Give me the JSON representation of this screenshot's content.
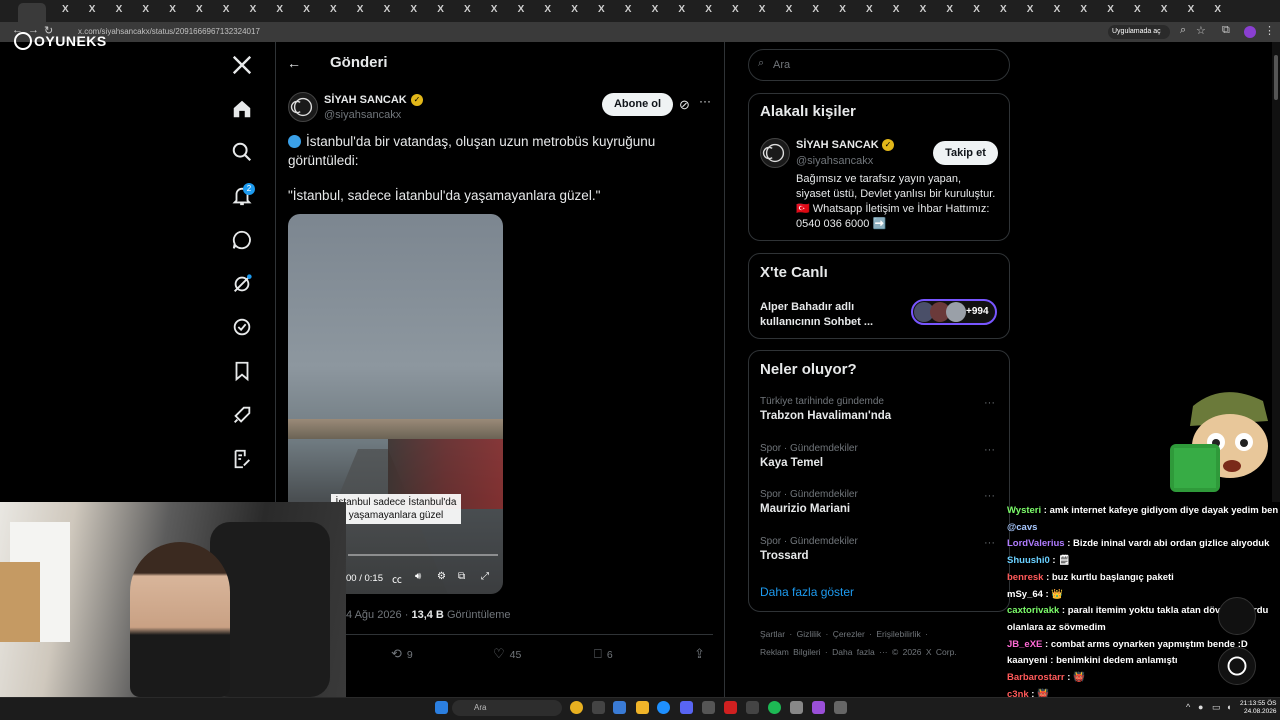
{
  "browser": {
    "url": "x.com/siyahsancakx/status/2091666967132324017",
    "app_chip": "Uygulamada aç"
  },
  "stream_overlay": {
    "logo_text": "OYUNEKS"
  },
  "nav": {
    "notification_count": "2",
    "icons": [
      "x-logo-icon",
      "home-icon",
      "search-icon",
      "bell-icon",
      "messages-icon",
      "grok-icon",
      "verified-org-icon",
      "bookmark-icon",
      "rocket-icon",
      "compose-list-icon"
    ]
  },
  "post": {
    "header_title": "Gönderi",
    "author_name": "SİYAH SANCAK",
    "author_handle": "@siyahsancakx",
    "subscribe_label": "Abone ol",
    "text_line1": "İstanbul'da bir vatandaş, oluşan uzun metrobüs kuyruğunu",
    "text_line2": "görüntüledi:",
    "text_line3": "\"İstanbul, sadece İatanbul'da yaşamayanlara güzel.\"",
    "video_caption": "İstanbul sadece İstanbul'da yaşamayanlara güzel",
    "video_time": "0:00 / 0:15",
    "video_time_visible": "00 / 0:15",
    "date": "4 Ağu 2026",
    "views": "13,4 B",
    "views_label": "Görüntüleme",
    "reposts": "9",
    "likes": "45",
    "bookmarks": "6"
  },
  "sidebar": {
    "search_placeholder": "Ara",
    "related": {
      "title": "Alakalı kişiler",
      "name": "SİYAH SANCAK",
      "handle": "@siyahsancakx",
      "follow_label": "Takip et",
      "bio": "Bağımsız ve tarafsız yayın yapan, siyaset üstü, Devlet yanlısı bir kuruluştur. 🇹🇷 Whatsapp İletişim ve İhbar Hattımız: 0540 036 6000 ➡️"
    },
    "live": {
      "title": "X'te Canlı",
      "text": "Alper Bahadır adlı kullanıcının Sohbet ...",
      "count": "+994"
    },
    "trends": {
      "title": "Neler oluyor?",
      "items": [
        {
          "meta": "Türkiye tarihinde gündemde",
          "name": "Trabzon Havalimanı'nda"
        },
        {
          "meta": "Spor · Gündemdekiler",
          "name": "Kaya Temel"
        },
        {
          "meta": "Spor · Gündemdekiler",
          "name": "Maurizio Mariani"
        },
        {
          "meta": "Spor · Gündemdekiler",
          "name": "Trossard"
        }
      ],
      "show_more": "Daha fazla göster"
    },
    "footer_line1": "Şartlar · Gizlilik · Çerezler · Erişilebilirlik ·",
    "footer_line2": "Reklam Bilgileri · Daha fazla ··· © 2026 X Corp."
  },
  "chat": [
    {
      "user": "Wysteri",
      "msg": " : amk internet kafeye gidiyom diye dayak yedim ben",
      "color": "#7cfc6a"
    },
    {
      "user": "@cavs",
      "msg": "",
      "color": "#a8c8ff"
    },
    {
      "user": "LordValerius",
      "msg": " : Bizde ininal vardı abi ordan gizlice alıyoduk",
      "color": "#b07cff"
    },
    {
      "user": "Shuushi0",
      "msg": " : 🗒",
      "color": "#6ad0ff"
    },
    {
      "user": "benresk",
      "msg": " : buz kurtlu başlangıç paketi",
      "color": "#ff5a5a"
    },
    {
      "user": "mSy_64",
      "msg": " : 👑",
      "color": "#ffffff"
    },
    {
      "user": "caxtorivakk",
      "msg": " : paralı itemim yoktu takla atan dövmeli kurdu",
      "color": "#7cfc6a"
    },
    {
      "user": "",
      "msg": "olanlara az sövmedim",
      "color": "#ffffff"
    },
    {
      "user": "JB_eXE",
      "msg": " : combat arms oynarken yapmıştım bende :D",
      "color": "#ff6ad5"
    },
    {
      "user": "kaanyeni",
      "msg": " : benimkini dedem anlamıştı",
      "color": "#ffffff"
    },
    {
      "user": "Barbarostarr",
      "msg": " : 👹",
      "color": "#ff5a5a"
    },
    {
      "user": "c3nk",
      "msg": " : 👹",
      "color": "#ff5a5a"
    }
  ],
  "taskbar": {
    "search_placeholder": "Ara",
    "time": "21:13:55 ÖS",
    "date": "24.08.2026"
  },
  "colors": {
    "accent": "#1d9bf0",
    "verified_gold": "#e2b719",
    "background": "#000000",
    "border": "#2f3336",
    "muted": "#71767b"
  }
}
